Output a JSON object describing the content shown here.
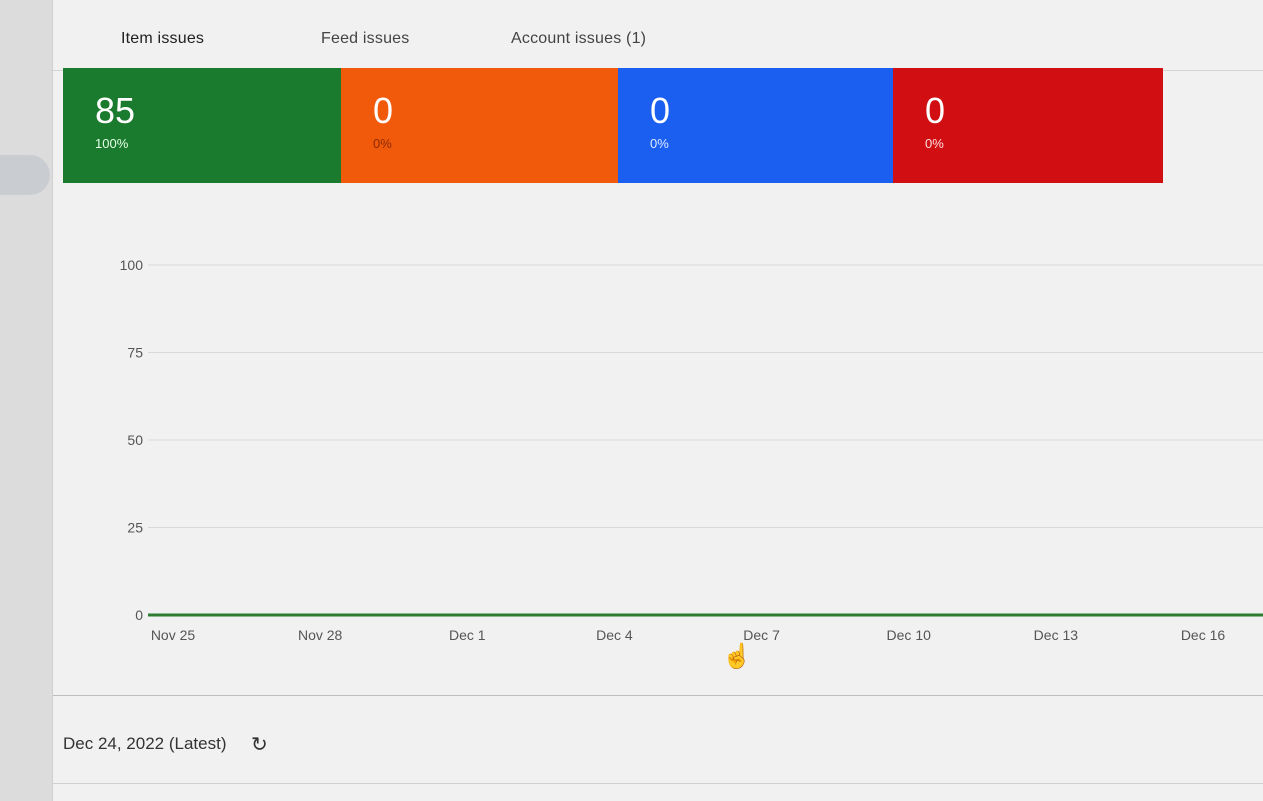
{
  "tabs": [
    {
      "label": "Item issues"
    },
    {
      "label": "Feed issues"
    },
    {
      "label": "Account issues (1)"
    }
  ],
  "tiles": [
    {
      "value": "85",
      "percent": "100%",
      "color": "#1a7a2e",
      "pct_color": "#e6ffe6"
    },
    {
      "value": "0",
      "percent": "0%",
      "color": "#f25a0b",
      "pct_color": "#8a2a00"
    },
    {
      "value": "0",
      "percent": "0%",
      "color": "#1a5ff0",
      "pct_color": "#e0ecff"
    },
    {
      "value": "0",
      "percent": "0%",
      "color": "#d10f13",
      "pct_color": "#ffe0e0"
    }
  ],
  "chart_data": {
    "type": "line",
    "x": [
      "Nov 25",
      "Nov 28",
      "Dec 1",
      "Dec 4",
      "Dec 7",
      "Dec 10",
      "Dec 13",
      "Dec 16"
    ],
    "series": [
      {
        "values": [
          0,
          0,
          0,
          0,
          0,
          0,
          0,
          0
        ],
        "color": "#2e7d32"
      }
    ],
    "yticks": [
      0,
      25,
      50,
      75,
      100
    ],
    "ylim": [
      0,
      100
    ],
    "grid": true
  },
  "footer": {
    "date_label": "Dec 24, 2022 (Latest)",
    "refresh_icon": "refresh-icon"
  }
}
